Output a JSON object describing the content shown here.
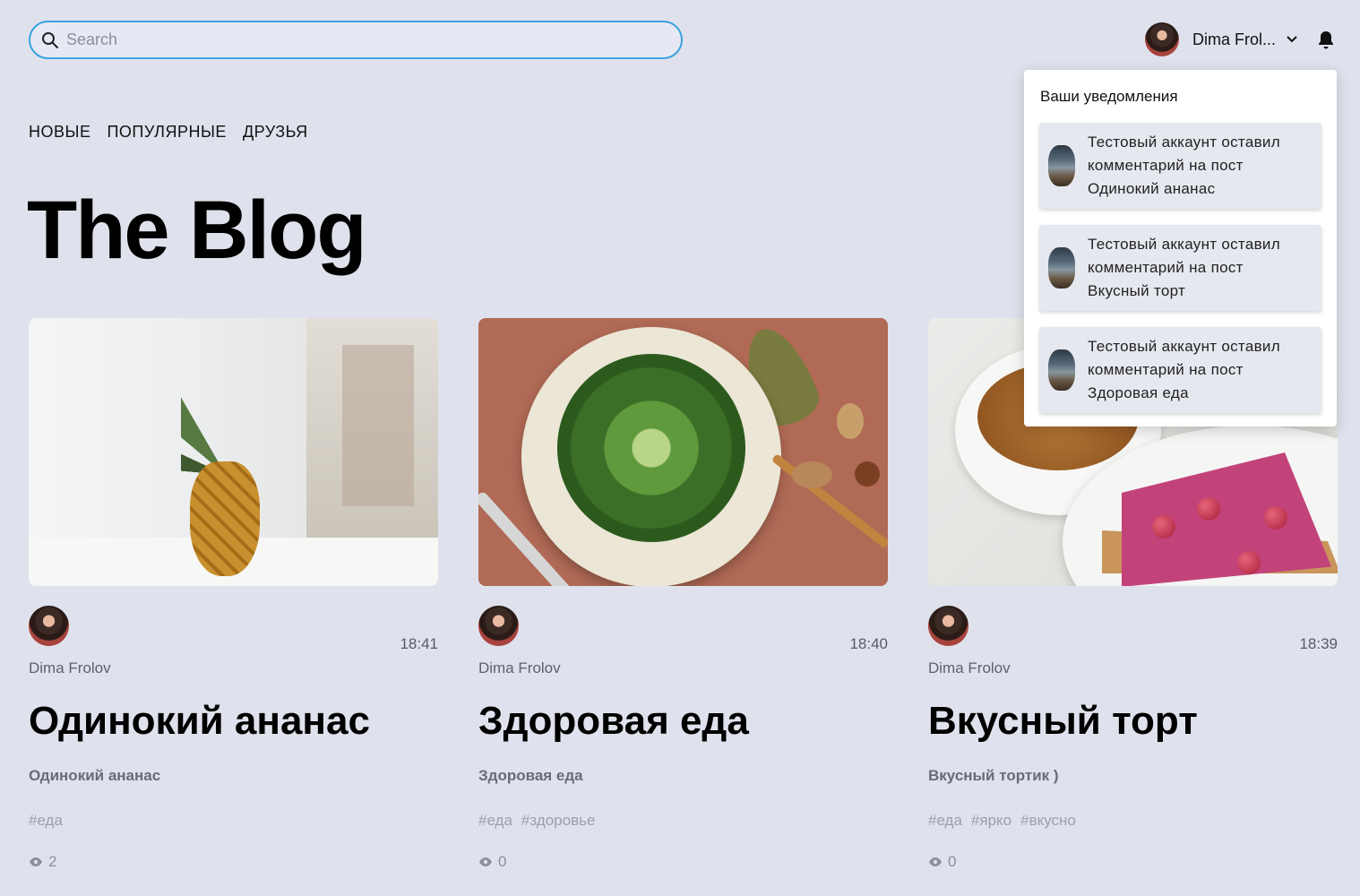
{
  "search": {
    "placeholder": "Search",
    "value": ""
  },
  "user": {
    "name": "Dima Frol..."
  },
  "nav": {
    "items": [
      "НОВЫЕ",
      "ПОПУЛЯРНЫЕ",
      "ДРУЗЬЯ"
    ]
  },
  "page": {
    "title": "The Blog"
  },
  "posts": [
    {
      "author": "Dima Frolov",
      "time": "18:41",
      "title": "Одинокий ананас",
      "description": "Одинокий ананас",
      "tags": [
        "#еда"
      ],
      "views": "2"
    },
    {
      "author": "Dima Frolov",
      "time": "18:40",
      "title": "Здоровая еда",
      "description": "Здоровая еда",
      "tags": [
        "#еда",
        "#здоровье"
      ],
      "views": "0"
    },
    {
      "author": "Dima Frolov",
      "time": "18:39",
      "title": "Вкусный торт",
      "description": "Вкусный тортик )",
      "tags": [
        "#еда",
        "#ярко",
        "#вкусно"
      ],
      "views": "0"
    }
  ],
  "notifications": {
    "title": "Ваши уведомления",
    "items": [
      {
        "line1": "Тестовый аккаунт оставил",
        "line2": "комментарий на пост",
        "line3": "Одинокий ананас"
      },
      {
        "line1": "Тестовый аккаунт оставил",
        "line2": "комментарий на пост",
        "line3": "Вкусный торт"
      },
      {
        "line1": "Тестовый аккаунт оставил",
        "line2": "комментарий на пост",
        "line3": "Здоровая еда"
      }
    ]
  },
  "colors": {
    "background": "#dfe2ec",
    "search_border": "#3ba2e0",
    "popover_bg": "#ffffff",
    "notification_bg": "#e6e8f0"
  },
  "icons": {
    "search": "search-icon",
    "chevron": "chevron-down-icon",
    "bell": "bell-icon",
    "views": "eye-icon"
  }
}
